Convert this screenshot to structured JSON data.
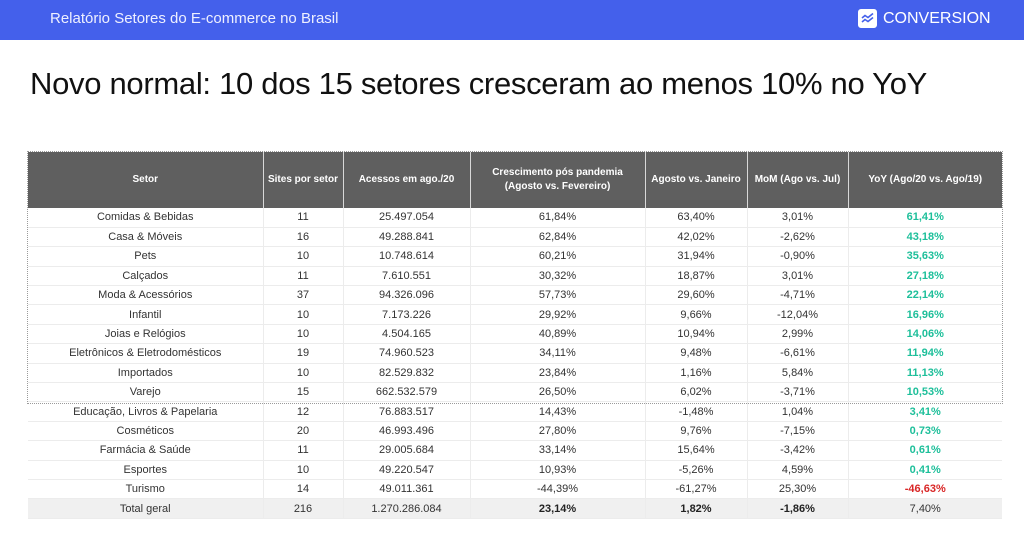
{
  "topbar": {
    "report_title": "Relatório Setores do E-commerce no Brasil",
    "brand_icon": "trend-chart-icon",
    "brand_name": "CONVERSION",
    "background_color": "#4460eb"
  },
  "headline": "Novo normal: 10 dos 15 setores cresceram ao menos 10% no YoY",
  "table": {
    "headers": [
      "Setor",
      "Sites por setor",
      "Acessos em ago./20",
      "Crescimento pós pandemia (Agosto vs. Fevereiro)",
      "Agosto vs. Janeiro",
      "MoM (Ago vs. Jul)",
      "YoY (Ago/20 vs. Ago/19)"
    ],
    "rows": [
      {
        "setor": "Comidas & Bebidas",
        "sites": "11",
        "acessos": "25.497.054",
        "pos_pandemia": "61,84%",
        "ago_jan": "63,40%",
        "mom": "3,01%",
        "yoy": "61,41%",
        "yoy_sign": "pos"
      },
      {
        "setor": "Casa & Móveis",
        "sites": "16",
        "acessos": "49.288.841",
        "pos_pandemia": "62,84%",
        "ago_jan": "42,02%",
        "mom": "-2,62%",
        "yoy": "43,18%",
        "yoy_sign": "pos"
      },
      {
        "setor": "Pets",
        "sites": "10",
        "acessos": "10.748.614",
        "pos_pandemia": "60,21%",
        "ago_jan": "31,94%",
        "mom": "-0,90%",
        "yoy": "35,63%",
        "yoy_sign": "pos"
      },
      {
        "setor": "Calçados",
        "sites": "11",
        "acessos": "7.610.551",
        "pos_pandemia": "30,32%",
        "ago_jan": "18,87%",
        "mom": "3,01%",
        "yoy": "27,18%",
        "yoy_sign": "pos"
      },
      {
        "setor": "Moda & Acessórios",
        "sites": "37",
        "acessos": "94.326.096",
        "pos_pandemia": "57,73%",
        "ago_jan": "29,60%",
        "mom": "-4,71%",
        "yoy": "22,14%",
        "yoy_sign": "pos"
      },
      {
        "setor": "Infantil",
        "sites": "10",
        "acessos": "7.173.226",
        "pos_pandemia": "29,92%",
        "ago_jan": "9,66%",
        "mom": "-12,04%",
        "yoy": "16,96%",
        "yoy_sign": "pos"
      },
      {
        "setor": "Joias e Relógios",
        "sites": "10",
        "acessos": "4.504.165",
        "pos_pandemia": "40,89%",
        "ago_jan": "10,94%",
        "mom": "2,99%",
        "yoy": "14,06%",
        "yoy_sign": "pos"
      },
      {
        "setor": "Eletrônicos & Eletrodomésticos",
        "sites": "19",
        "acessos": "74.960.523",
        "pos_pandemia": "34,11%",
        "ago_jan": "9,48%",
        "mom": "-6,61%",
        "yoy": "11,94%",
        "yoy_sign": "pos"
      },
      {
        "setor": "Importados",
        "sites": "10",
        "acessos": "82.529.832",
        "pos_pandemia": "23,84%",
        "ago_jan": "1,16%",
        "mom": "5,84%",
        "yoy": "11,13%",
        "yoy_sign": "pos"
      },
      {
        "setor": "Varejo",
        "sites": "15",
        "acessos": "662.532.579",
        "pos_pandemia": "26,50%",
        "ago_jan": "6,02%",
        "mom": "-3,71%",
        "yoy": "10,53%",
        "yoy_sign": "pos"
      },
      {
        "setor": "Educação, Livros & Papelaria",
        "sites": "12",
        "acessos": "76.883.517",
        "pos_pandemia": "14,43%",
        "ago_jan": "-1,48%",
        "mom": "1,04%",
        "yoy": "3,41%",
        "yoy_sign": "pos"
      },
      {
        "setor": "Cosméticos",
        "sites": "20",
        "acessos": "46.993.496",
        "pos_pandemia": "27,80%",
        "ago_jan": "9,76%",
        "mom": "-7,15%",
        "yoy": "0,73%",
        "yoy_sign": "pos"
      },
      {
        "setor": "Farmácia & Saúde",
        "sites": "11",
        "acessos": "29.005.684",
        "pos_pandemia": "33,14%",
        "ago_jan": "15,64%",
        "mom": "-3,42%",
        "yoy": "0,61%",
        "yoy_sign": "pos"
      },
      {
        "setor": "Esportes",
        "sites": "10",
        "acessos": "49.220.547",
        "pos_pandemia": "10,93%",
        "ago_jan": "-5,26%",
        "mom": "4,59%",
        "yoy": "0,41%",
        "yoy_sign": "pos"
      },
      {
        "setor": "Turismo",
        "sites": "14",
        "acessos": "49.011.361",
        "pos_pandemia": "-44,39%",
        "ago_jan": "-61,27%",
        "mom": "25,30%",
        "yoy": "-46,63%",
        "yoy_sign": "neg"
      }
    ],
    "total": {
      "setor": "Total geral",
      "sites": "216",
      "acessos": "1.270.286.084",
      "pos_pandemia": "23,14%",
      "ago_jan": "1,82%",
      "mom": "-1,86%",
      "yoy": "7,40%"
    },
    "colors": {
      "header_bg": "#5f5f5f",
      "yoy_positive": "#1dbf9a",
      "yoy_negative": "#d92626",
      "total_bg": "#f0f0f0"
    }
  }
}
